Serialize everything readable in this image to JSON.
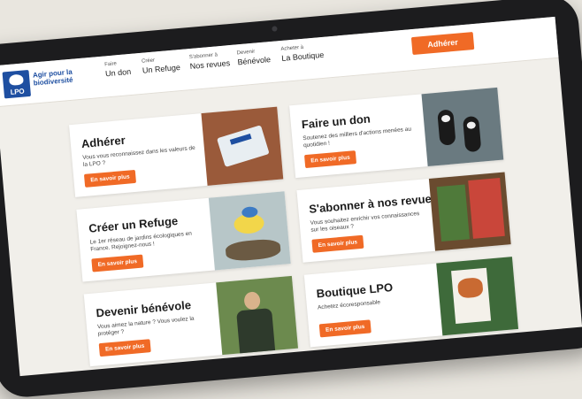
{
  "logo": {
    "text": "LPO",
    "tagline": "Agir pour la biodiversité"
  },
  "nav": [
    {
      "small": "Faire",
      "big": "Un don"
    },
    {
      "small": "Créer",
      "big": "Un Refuge"
    },
    {
      "small": "S'abonner à",
      "big": "Nos revues"
    },
    {
      "small": "Devenir",
      "big": "Bénévole"
    },
    {
      "small": "Acheter à",
      "big": "La Boutique"
    }
  ],
  "cta": "Adhérer",
  "cards": [
    {
      "title": "Adhérer",
      "text": "Vous vous reconnaissez dans les valeurs de la LPO ?",
      "button": "En savoir plus",
      "image": "membership-card-photo"
    },
    {
      "title": "Faire un don",
      "text": "Soutenez des milliers d'actions menées au quotidien !",
      "button": "En savoir plus",
      "image": "puffins-photo"
    },
    {
      "title": "Créer un Refuge",
      "text": "Le 1er réseau de jardins écologiques en France. Rejoignez-nous !",
      "button": "En savoir plus",
      "image": "blue-tit-photo"
    },
    {
      "title": "S'abonner à nos revues",
      "text": "Vous souhaitez enrichir vos connaissances sur les oiseaux ?",
      "button": "En savoir plus",
      "image": "magazines-photo"
    },
    {
      "title": "Devenir bénévole",
      "text": "Vous aimez la nature ? Vous voulez la protéger ?",
      "button": "En savoir plus",
      "image": "volunteer-photo"
    },
    {
      "title": "Boutique LPO",
      "text": "Achetez écoresponsable",
      "button": "En savoir plus",
      "image": "shop-photo"
    }
  ],
  "colors": {
    "accent": "#f06a26",
    "brand": "#1e4fa1",
    "background": "#f1efea"
  }
}
